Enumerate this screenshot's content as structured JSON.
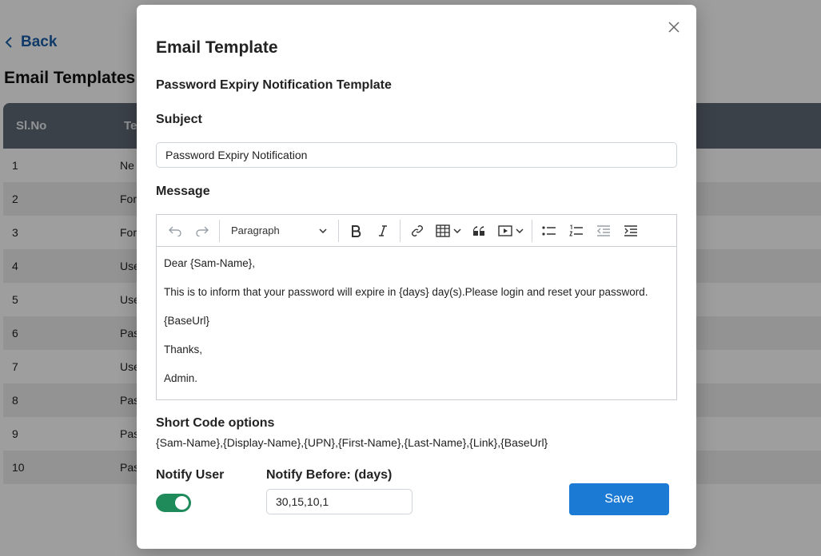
{
  "background": {
    "back_label": "Back",
    "page_title": "Email Templates",
    "table": {
      "headers": [
        "Sl.No",
        "Te"
      ],
      "rows": [
        {
          "sl": "1",
          "name": "Ne"
        },
        {
          "sl": "2",
          "name": "For"
        },
        {
          "sl": "3",
          "name": "For"
        },
        {
          "sl": "4",
          "name": "Use"
        },
        {
          "sl": "5",
          "name": "Use"
        },
        {
          "sl": "6",
          "name": "Pas"
        },
        {
          "sl": "7",
          "name": "Use"
        },
        {
          "sl": "8",
          "name": "Pas"
        },
        {
          "sl": "9",
          "name": "Pas"
        },
        {
          "sl": "10",
          "name": "Pas"
        }
      ]
    }
  },
  "modal": {
    "title": "Email Template",
    "template_name": "Password Expiry Notification Template",
    "subject_label": "Subject",
    "subject_value": "Password Expiry Notification",
    "message_label": "Message",
    "toolbar": {
      "block_format": "Paragraph",
      "icons": [
        "undo-icon",
        "redo-icon",
        "bold-icon",
        "italic-icon",
        "link-icon",
        "table-icon",
        "blockquote-icon",
        "media-icon",
        "bulleted-list-icon",
        "numbered-list-icon",
        "outdent-icon",
        "indent-icon"
      ]
    },
    "message_lines": [
      "Dear {Sam-Name},",
      "This is to inform that your password will expire in {days} day(s).Please login and reset your password.",
      "{BaseUrl}",
      "Thanks,",
      "Admin."
    ],
    "short_code_title": "Short Code options",
    "short_codes": "{Sam-Name},{Display-Name},{UPN},{First-Name},{Last-Name},{Link},{BaseUrl}",
    "notify_user_label": "Notify User",
    "notify_user_enabled": true,
    "notify_before_label": "Notify Before: (days)",
    "notify_before_value": "30,15,10,1",
    "save_label": "Save"
  },
  "colors": {
    "accent": "#1a7ad4",
    "toggle_on": "#1f8a5a",
    "table_header": "#5f6a74",
    "back_link": "#1a5fa8"
  }
}
